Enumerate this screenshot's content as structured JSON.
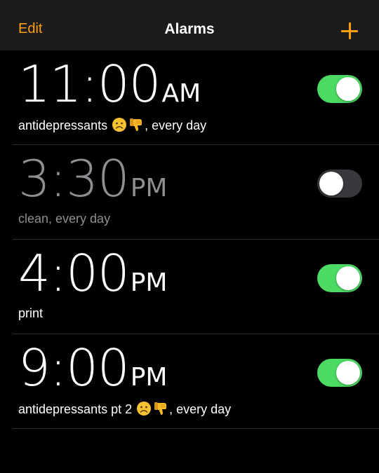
{
  "nav": {
    "edit_label": "Edit",
    "title": "Alarms",
    "add_icon": "plus-icon"
  },
  "colors": {
    "accent": "#ff9f0a",
    "toggle_on": "#4cd964",
    "toggle_off": "#39393d",
    "inactive_text": "#8e8e93"
  },
  "alarms": [
    {
      "time": "11:00",
      "period": "AM",
      "label_before": "antidepressants",
      "label_after": ", every day",
      "emojis": [
        "frowning-face-emoji",
        "thumbs-down-emoji"
      ],
      "enabled": true
    },
    {
      "time": "3:30",
      "period": "PM",
      "label_before": "clean, every day",
      "label_after": "",
      "emojis": [],
      "enabled": false
    },
    {
      "time": "4:00",
      "period": "PM",
      "label_before": "print",
      "label_after": "",
      "emojis": [],
      "enabled": true
    },
    {
      "time": "9:00",
      "period": "PM",
      "label_before": "antidepressants pt 2",
      "label_after": ", every day",
      "emojis": [
        "frowning-face-emoji",
        "thumbs-down-emoji"
      ],
      "enabled": true
    }
  ]
}
